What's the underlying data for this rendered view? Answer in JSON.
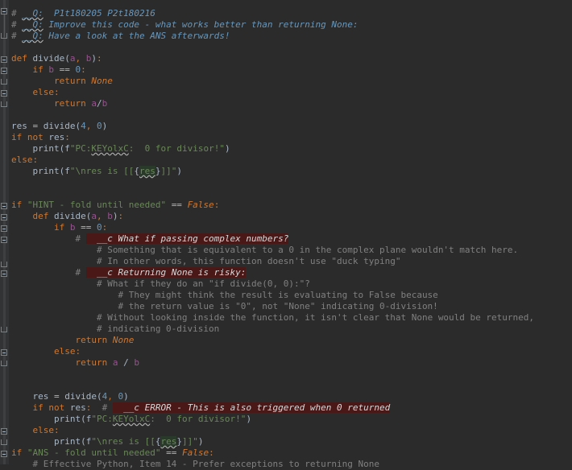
{
  "lines": [
    {
      "t": "# __Q:  P1t180205 P2t180216"
    },
    {
      "t": "# __Q: Improve this code - what works better than returning None:"
    },
    {
      "t": "# __Q: Have a look at the ANS afterwards!"
    },
    {
      "t": ""
    },
    {
      "t": "def divide(a, b):"
    },
    {
      "t": "    if b == 0:"
    },
    {
      "t": "        return None"
    },
    {
      "t": "    else:"
    },
    {
      "t": "        return a/b"
    },
    {
      "t": ""
    },
    {
      "t": "res = divide(4, 0)"
    },
    {
      "t": "if not res:"
    },
    {
      "t": "    print(f\"PC:KEYolxC:  0 for divisor!\")"
    },
    {
      "t": "else:"
    },
    {
      "t": "    print(f\"\\nres is [[{res}]]\")"
    },
    {
      "t": ""
    },
    {
      "t": ""
    },
    {
      "t": "if \"HINT - fold until needed\" == False:"
    },
    {
      "t": "    def divide(a, b):"
    },
    {
      "t": "        if b == 0:"
    },
    {
      "t": "            # __c What if passing complex numbers?"
    },
    {
      "t": "                # Something that is equivalent to a 0 in the complex plane wouldn't match here."
    },
    {
      "t": "                # In other words, this function doesn't use \"duck typing\""
    },
    {
      "t": "            # __c Returning None is risky:"
    },
    {
      "t": "                # What if they do an \"if divide(0, 0):\"?"
    },
    {
      "t": "                    # They might think the result is evaluating to False because"
    },
    {
      "t": "                    # the return value is \"0\", not \"None\" indicating 0-division!"
    },
    {
      "t": "                # Without looking inside the function, it isn't clear that None would be returned,"
    },
    {
      "t": "                # indicating 0-division"
    },
    {
      "t": "            return None"
    },
    {
      "t": "        else:"
    },
    {
      "t": "            return a / b"
    },
    {
      "t": ""
    },
    {
      "t": ""
    },
    {
      "t": "    res = divide(4, 0)"
    },
    {
      "t": "    if not res:  # __c ERROR - This is also triggered when 0 returned"
    },
    {
      "t": "        print(f\"PC:KEYolxC:  0 for divisor!\")"
    },
    {
      "t": "    else:"
    },
    {
      "t": "        print(f\"\\nres is [[{res}]]\")"
    },
    {
      "t": "if \"ANS - fold until needed\" == False:"
    },
    {
      "t": "    # Effective Python, Item 14 - Prefer exceptions to returning None"
    }
  ]
}
